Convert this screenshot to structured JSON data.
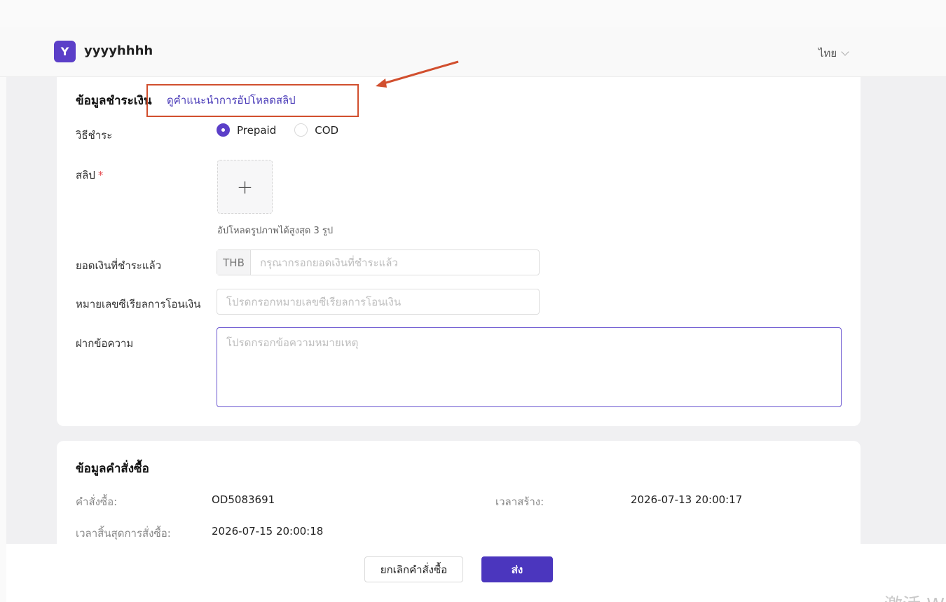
{
  "header": {
    "logo_letter": "Y",
    "shop_name": "yyyyhhhh",
    "language": "ไทย"
  },
  "payment": {
    "section_title": "ข้อมูลชำระเงิน",
    "guide_link": "ดูคำแนะนำการอัปโหลดสลิป",
    "method_label": "วิธีชำระ",
    "methods": [
      {
        "label": "Prepaid",
        "checked": true
      },
      {
        "label": "COD",
        "checked": false
      }
    ],
    "slip_label": "สลิป",
    "required_mark": "*",
    "upload_plus": "+",
    "upload_hint": "อัปโหลดรูปภาพได้สูงสุด 3 รูป",
    "amount_label": "ยอดเงินที่ชำระแล้ว",
    "amount_currency": "THB",
    "amount_placeholder": "กรุณากรอกยอดเงินที่ชำระแล้ว",
    "serial_label": "หมายเลขซีเรียลการโอนเงิน",
    "serial_placeholder": "โปรดกรอกหมายเลขซีเรียลการโอนเงิน",
    "message_label": "ฝากข้อความ",
    "message_placeholder": "โปรดกรอกข้อความหมายเหตุ"
  },
  "order": {
    "section_title": "ข้อมูลคำสั่งซื้อ",
    "order_no_label": "คำสั่งซื้อ:",
    "order_no_value": "OD5083691",
    "created_label": "เวลาสร้าง:",
    "created_value": "2026-07-13 20:00:17",
    "expire_label": "เวลาสิ้นสุดการสั่งซื้อ:",
    "expire_value": "2026-07-15 20:00:18"
  },
  "footer": {
    "cancel_label": "ยกเลิกคำสั่งซื้อ",
    "submit_label": "ส่ง"
  },
  "colors": {
    "brand": "#5b3fc8",
    "annotation": "#d14f2e"
  },
  "watermark": "激活 W"
}
